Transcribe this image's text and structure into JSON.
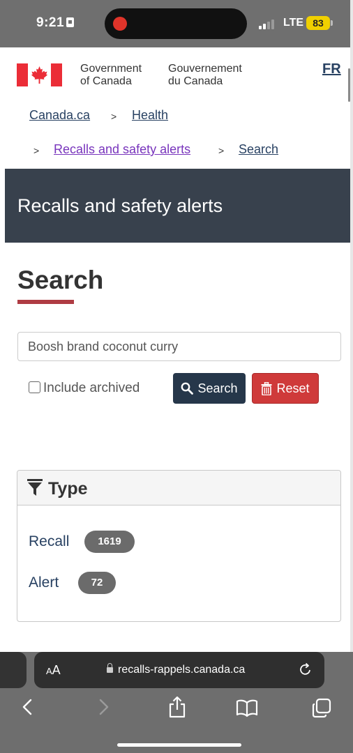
{
  "status_bar": {
    "time": "9:21",
    "network": "LTE",
    "battery": "83"
  },
  "header": {
    "gov_en_line1": "Government",
    "gov_en_line2": "of Canada",
    "gov_fr_line1": "Gouvernement",
    "gov_fr_line2": "du Canada",
    "language_toggle": "FR"
  },
  "breadcrumbs": {
    "items": [
      "Canada.ca",
      "Health",
      "Recalls and safety alerts",
      "Search"
    ],
    "separator": ">"
  },
  "banner": {
    "title": "Recalls and safety alerts"
  },
  "main": {
    "heading": "Search",
    "search_value": "Boosh brand coconut curry",
    "include_archived_label": "Include archived",
    "search_button": "Search",
    "reset_button": "Reset"
  },
  "facet_panel": {
    "title": "Type",
    "items": [
      {
        "label": "Recall",
        "count": "1619"
      },
      {
        "label": "Alert",
        "count": "72"
      }
    ]
  },
  "browser": {
    "text_size_label_small": "A",
    "text_size_label_large": "A",
    "url": "recalls-rappels.canada.ca"
  },
  "colors": {
    "banner_bg": "#38414d",
    "link": "#284162",
    "visited_link": "#7834bc",
    "search_btn": "#26374a",
    "reset_btn": "#cf3a3a",
    "heading_underline": "#af3c43",
    "flag_red": "#eb2d37"
  },
  "icons": [
    "canada-flag-icon",
    "search-icon",
    "trash-icon",
    "filter-icon",
    "lock-icon",
    "reload-icon",
    "back-icon",
    "forward-icon",
    "share-icon",
    "bookmarks-icon",
    "tabs-icon"
  ]
}
